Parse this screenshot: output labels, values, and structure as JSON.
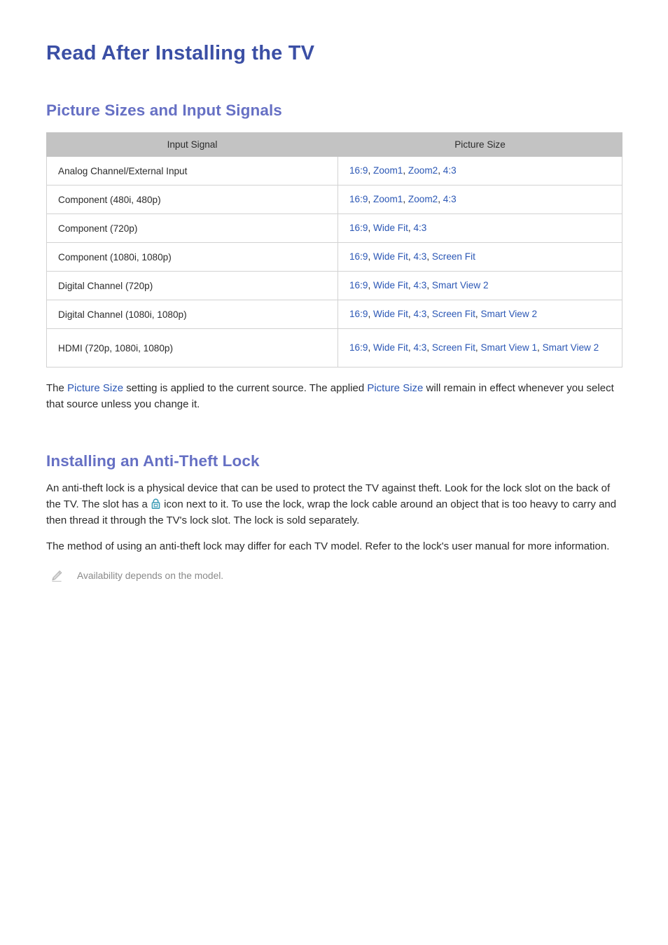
{
  "document": {
    "title": "Read After Installing the TV"
  },
  "sections": [
    {
      "heading": "Picture Sizes and Input Signals"
    },
    {
      "heading": "Installing an Anti-Theft Lock"
    }
  ],
  "table": {
    "headers": [
      "Input Signal",
      "Picture Size"
    ],
    "rows": [
      {
        "signal": "Analog Channel/External Input",
        "sizes": "16:9, Zoom1, Zoom2, 4:3"
      },
      {
        "signal": "Component (480i, 480p)",
        "sizes": "16:9, Zoom1, Zoom2, 4:3"
      },
      {
        "signal": "Component (720p)",
        "sizes": "16:9, Wide Fit, 4:3"
      },
      {
        "signal": "Component (1080i, 1080p)",
        "sizes": "16:9, Wide Fit, 4:3, Screen Fit"
      },
      {
        "signal": "Digital Channel (720p)",
        "sizes": "16:9, Wide Fit, 4:3, Smart View 2"
      },
      {
        "signal": "Digital Channel (1080i, 1080p)",
        "sizes": "16:9, Wide Fit, 4:3, Screen Fit, Smart View 2"
      },
      {
        "signal": "HDMI (720p, 1080i, 1080p)",
        "sizes": "16:9, Wide Fit, 4:3, Screen Fit, Smart View 1, Smart View 2"
      }
    ]
  },
  "picture_size_note": {
    "part1": "The ",
    "term1": "Picture Size",
    "part2": " setting is applied to the current source. The applied ",
    "term2": "Picture Size",
    "part3": " will remain in effect whenever you select that source unless you change it."
  },
  "anti_theft": {
    "paragraph1_a": "An anti-theft lock is a physical device that can be used to protect the TV against theft. Look for the lock slot on the back of the TV. The slot has a ",
    "paragraph1_b": " icon next to it. To use the lock, wrap the lock cable around an object that is too heavy to carry and then thread it through the TV's lock slot. The lock is sold separately.",
    "paragraph2": "The method of using an anti-theft lock may differ for each TV model. Refer to the lock's user manual for more information.",
    "note": "Availability depends on the model."
  },
  "icons": {
    "lock": "lock-icon",
    "pencil": "pencil-icon"
  },
  "colors": {
    "title_blue": "#3b4fa5",
    "heading_blue": "#6670c4",
    "link_blue": "#2b57b5",
    "table_header_gray": "#c3c3c3",
    "note_gray": "#8a8a8a",
    "lock_teal": "#3a9bb5"
  }
}
